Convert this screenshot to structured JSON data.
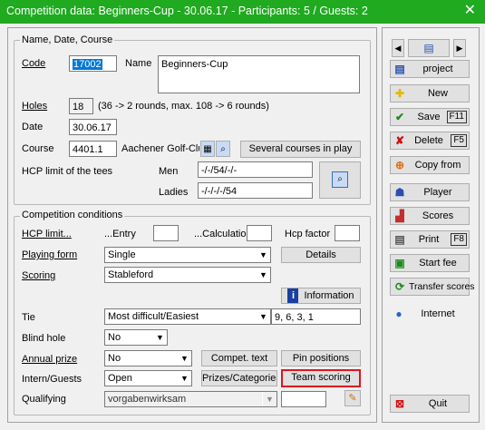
{
  "window": {
    "title": "Competition data: Beginners-Cup - 30.06.17 - Participants: 5 / Guests: 2",
    "close": "✕"
  },
  "basics": {
    "legend": "Name, Date, Course",
    "code_label": "Code",
    "code_value": "17002",
    "name_label": "Name",
    "name_value": "Beginners-Cup",
    "holes_label": "Holes",
    "holes_value": "18",
    "holes_hint": "(36 -> 2 rounds, max. 108 -> 6 rounds)",
    "date_label": "Date",
    "date_value": "30.06.17",
    "course_label": "Course",
    "course_value": "4401.1",
    "course_name": "Aachener Golf-Clu",
    "several_courses": "Several courses in play",
    "hcp_tees_label": "HCP limit of the tees",
    "men_label": "Men",
    "men_value": "-/-/54/-/-",
    "ladies_label": "Ladies",
    "ladies_value": "-/-/-/-/54"
  },
  "conditions": {
    "legend": "Competition conditions",
    "hcp_limit_label": "HCP limit...",
    "entry_label": "...Entry",
    "calc_label": "...Calculation",
    "hcp_factor_label": "Hcp factor",
    "playing_form_label": "Playing form",
    "playing_form_value": "Single",
    "details": "Details",
    "scoring_label": "Scoring",
    "scoring_value": "Stableford",
    "information": "Information",
    "tie_label": "Tie",
    "tie_value": "Most difficult/Easiest",
    "tie_holes": "9, 6, 3, 1",
    "blind_hole_label": "Blind hole",
    "blind_hole_value": "No",
    "annual_prize_label": "Annual prize",
    "annual_prize_value": "No",
    "compet_text": "Compet. text",
    "pin_positions": "Pin positions",
    "intern_label": "Intern/Guests",
    "intern_value": "Open",
    "prizes_categories": "Prizes/Categories",
    "team_scoring": "Team scoring",
    "qualifying_label": "Qualifying",
    "qualifying_value": "vorgabenwirksam"
  },
  "side": {
    "project": "project",
    "new": "New",
    "save": "Save",
    "save_key": "F11",
    "delete": "Delete",
    "delete_key": "F5",
    "copy_from": "Copy from",
    "player": "Player",
    "scores": "Scores",
    "print": "Print",
    "print_key": "F8",
    "start_fee": "Start fee",
    "transfer_scores": "Transfer scores",
    "internet": "Internet",
    "quit": "Quit"
  },
  "colors": {
    "titlebar": "#1faa1f",
    "highlight": "#e0141e",
    "selection": "#0078d7"
  }
}
